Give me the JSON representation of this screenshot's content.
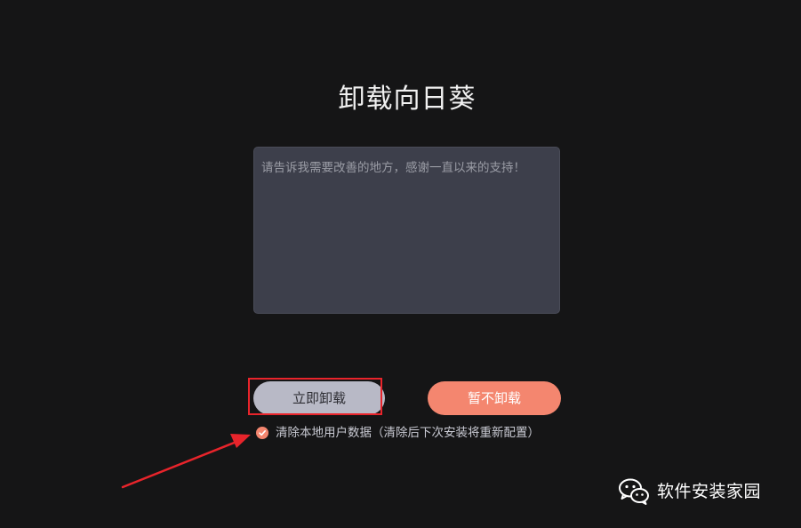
{
  "dialog": {
    "title": "卸载向日葵",
    "feedback_placeholder": "请告诉我需要改善的地方，感谢一直以来的支持！",
    "uninstall_button": "立即卸载",
    "cancel_button": "暂不卸载",
    "clear_data_label": "清除本地用户数据（清除后下次安装将重新配置）",
    "clear_data_checked": true
  },
  "annotation": {
    "highlight_color": "#e8242b",
    "arrow_color": "#e8242b"
  },
  "watermark": {
    "icon": "wechat-icon",
    "text": "软件安装家园"
  },
  "colors": {
    "background": "#151516",
    "accent": "#f4866f",
    "textarea_bg": "#3d3f4b",
    "uninstall_button_bg": "#b8b9c6"
  }
}
